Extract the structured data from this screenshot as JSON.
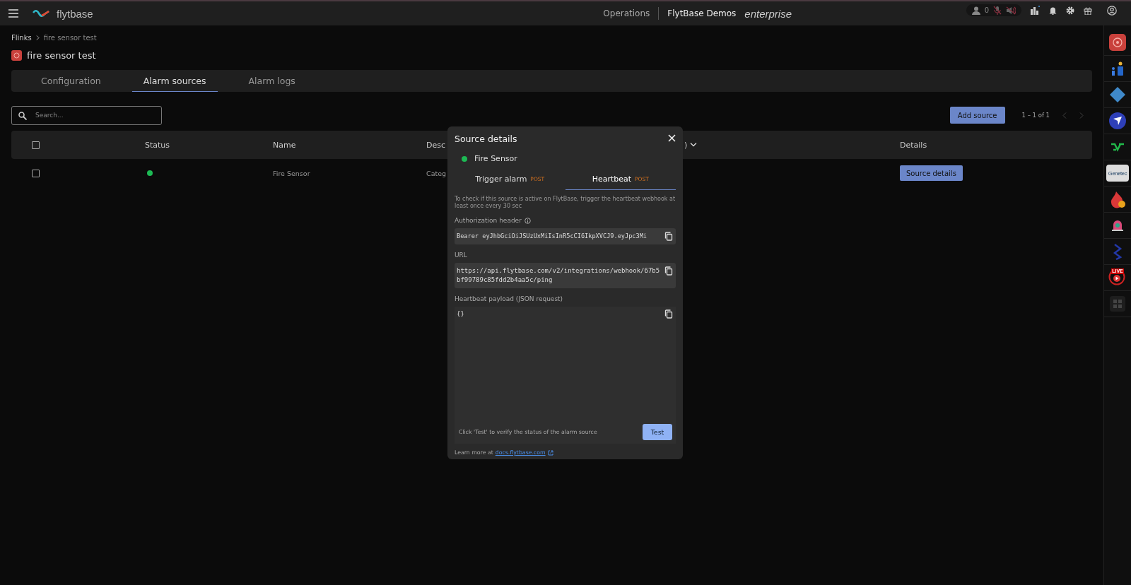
{
  "topbar": {
    "brand": "flytbase",
    "nav": "Operations",
    "org": "FlytBase Demos",
    "plan": "enterprise",
    "user_count": "0"
  },
  "breadcrumb": [
    "Flinks",
    "fire sensor test"
  ],
  "page_title": "fire sensor test",
  "tabs": [
    {
      "label": "Configuration",
      "selected": false
    },
    {
      "label": "Alarm sources",
      "selected": true
    },
    {
      "label": "Alarm logs",
      "selected": false
    }
  ],
  "search": {
    "placeholder": "Search..."
  },
  "add_button": "Add source",
  "pagination": "1 – 1 of 1",
  "table": {
    "columns": [
      "Status",
      "Name",
      "Desc",
      ")",
      "Details"
    ],
    "select_all_checked": false,
    "rows": [
      {
        "checked": false,
        "online": true,
        "name": "Fire Sensor",
        "description": "Categ",
        "action": "Source details"
      }
    ]
  },
  "modal": {
    "title": "Source details",
    "source": "Fire Sensor",
    "source_online": true,
    "tabs": [
      {
        "label": "Trigger alarm",
        "method": "POST",
        "selected": false
      },
      {
        "label": "Heartbeat",
        "method": "POST",
        "selected": true
      }
    ],
    "note": "To check if this source is active on FlytBase, trigger the heartbeat webhook at least once every 30 sec",
    "auth_label": "Authorization header",
    "auth_value": "Bearer eyJhbGciOiJSUzUxMiIsInR5cCI6IkpXVCJ9.eyJpc3Mi",
    "url_label": "URL",
    "url_value": "https://api.flytbase.com/v2/integrations/webhook/67b5bf99789c85fdd2b4aa5c/ping",
    "payload_label": "Heartbeat payload (JSON request)",
    "payload_value": "{}",
    "test_hint": "Click 'Test' to verify the status of the alarm source",
    "test_button": "Test",
    "learn_more": "Learn more at",
    "docs_link": "docs.flytbase.com"
  },
  "sidebar_apps": [
    {
      "kind": "alarm"
    },
    {
      "kind": "people"
    },
    {
      "kind": "diamond"
    },
    {
      "kind": "plane"
    },
    {
      "kind": "wave"
    },
    {
      "kind": "genetec",
      "label": "Genetec"
    },
    {
      "kind": "fire"
    },
    {
      "kind": "bell"
    },
    {
      "kind": "seven"
    },
    {
      "kind": "live",
      "label": "LIVE"
    },
    {
      "kind": "grid"
    }
  ]
}
